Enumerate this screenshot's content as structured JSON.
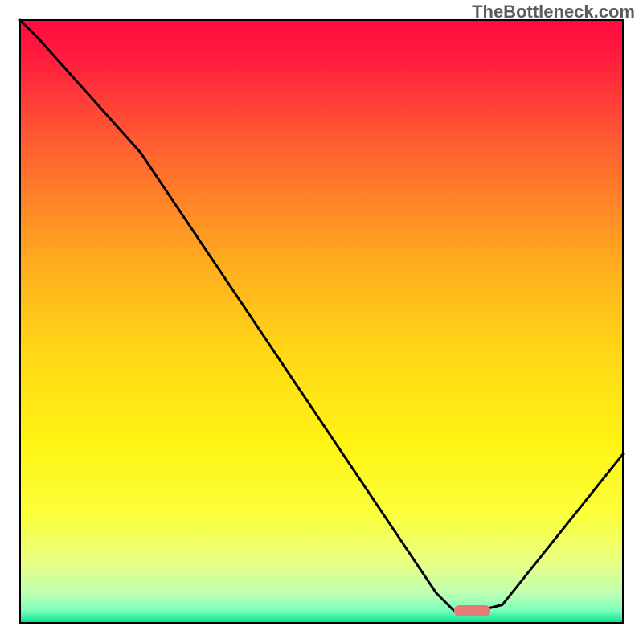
{
  "watermark": "TheBottleneck.com",
  "chart_data": {
    "type": "line",
    "title": "",
    "xlabel": "",
    "ylabel": "",
    "xlim": [
      0,
      100
    ],
    "ylim": [
      0,
      100
    ],
    "x": [
      0,
      3,
      20,
      69,
      72,
      76,
      80,
      100
    ],
    "values": [
      100,
      97,
      78,
      5,
      2,
      2,
      3,
      28
    ],
    "marker": {
      "x_start": 72,
      "x_end": 78,
      "y": 2
    },
    "axes_visible": false,
    "background": "red-yellow-green-gradient"
  }
}
